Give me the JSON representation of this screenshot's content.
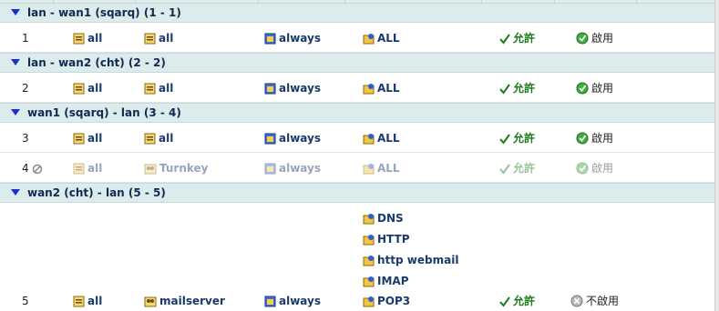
{
  "groups": [
    {
      "title": "lan - wan1 (sqarq) (1 - 1)"
    },
    {
      "title": "lan - wan2 (cht) (2 - 2)"
    },
    {
      "title": "wan1 (sqarq) - lan (3 - 4)"
    },
    {
      "title": "wan2 (cht) - lan (5 - 5)"
    }
  ],
  "rows": [
    {
      "num": "1",
      "src": "all",
      "dst": "all",
      "schedule": "always",
      "service": "ALL",
      "action": "允許",
      "status": "啟用"
    },
    {
      "num": "2",
      "src": "all",
      "dst": "all",
      "schedule": "always",
      "service": "ALL",
      "action": "允許",
      "status": "啟用"
    },
    {
      "num": "3",
      "src": "all",
      "dst": "all",
      "schedule": "always",
      "service": "ALL",
      "action": "允許",
      "status": "啟用"
    },
    {
      "num": "4",
      "src": "all",
      "dst": "Turnkey",
      "schedule": "always",
      "service": "ALL",
      "action": "允許",
      "status": "啟用",
      "disabled": true
    },
    {
      "num": "5",
      "src": "all",
      "dst": "mailserver",
      "schedule": "always",
      "services": [
        "DNS",
        "HTTP",
        "http webmail",
        "IMAP",
        "POP3"
      ],
      "action": "允許",
      "status": "不啟用"
    }
  ],
  "colors": {
    "header_bg": "#dcecec",
    "text": "#1a3a6b",
    "ok_green": "#1e7a1e",
    "triangle": "#1a2fd0"
  }
}
